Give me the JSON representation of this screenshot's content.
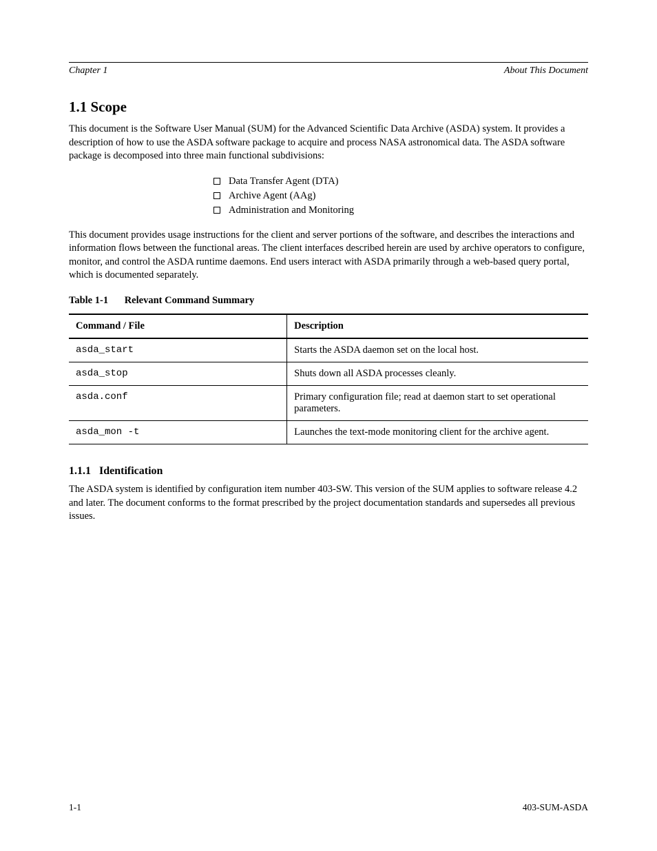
{
  "header": {
    "chapter": "Chapter 1",
    "title": "About This Document"
  },
  "section": {
    "heading": "1.1   Scope",
    "para1": "This document is the Software User Manual (SUM) for the Advanced Scientific Data Archive (ASDA) system. It provides a description of how to use the ASDA software package to acquire and process NASA astronomical data. The ASDA software package is decomposed into three main functional subdivisions:",
    "bullets": [
      "Data Transfer Agent (DTA)",
      "Archive Agent (AAg)",
      "Administration and Monitoring"
    ],
    "para2": "This document provides usage instructions for the client and server portions of the software, and describes the interactions and information flows between the functional areas. The client interfaces described herein are used by archive operators to configure, monitor, and control the ASDA runtime daemons. End users interact with ASDA primarily through a web-based query portal, which is documented separately."
  },
  "table": {
    "caption_label": "Table 1-1",
    "caption_title": "Relevant Command Summary",
    "headers": [
      "Command / File",
      "Description"
    ],
    "rows": [
      {
        "cmd": "asda_start",
        "desc": "Starts the ASDA daemon set on the local host."
      },
      {
        "cmd": "asda_stop",
        "desc": "Shuts down all ASDA processes cleanly."
      },
      {
        "cmd": "asda.conf",
        "desc": "Primary configuration file; read at daemon start to set operational parameters."
      },
      {
        "cmd": "asda_mon -t",
        "desc": "Launches the text-mode monitoring client for the archive agent."
      }
    ]
  },
  "subsection": {
    "number": "1.1.1",
    "title": "Identification",
    "text": "The ASDA system is identified by configuration item number 403-SW. This version of the SUM applies to software release 4.2 and later. The document conforms to the format prescribed by the project documentation standards and supersedes all previous issues."
  },
  "footer": {
    "page": "1-1",
    "docid": "403-SUM-ASDA"
  }
}
